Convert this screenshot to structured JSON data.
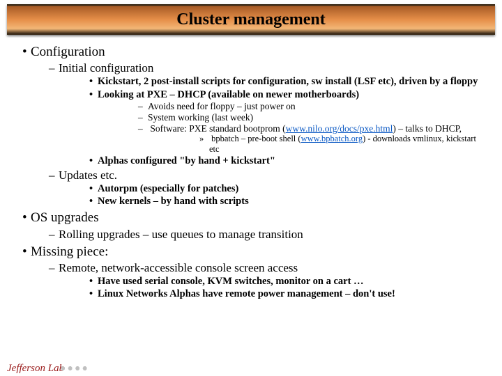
{
  "title": "Cluster management",
  "logo": "Jefferson Lab",
  "b1": {
    "text": "Configuration",
    "s1": {
      "text": "Initial configuration",
      "i1": "Kickstart, 2 post-install scripts for configuration, sw install (LSF etc), driven by a floppy",
      "i2": {
        "text": "Looking at PXE – DHCP (available on newer motherboards)",
        "d1": "Avoids need for floppy – just power on",
        "d2": "System working (last week)",
        "d3a": "Software: PXE standard bootprom (",
        "d3link": "www.nilo.org/docs/pxe.html",
        "d3b": ") – talks to DHCP,",
        "d3s1a": "bpbatch – pre-boot shell (",
        "d3s1link": "www.bpbatch.org",
        "d3s1b": ") - downloads vmlinux, kickstart etc"
      },
      "i3": "Alphas configured \"by hand + kickstart\""
    },
    "s2": {
      "text": "Updates etc.",
      "i1": "Autorpm (especially for patches)",
      "i2": "New kernels – by hand with scripts"
    }
  },
  "b2": {
    "text": "OS upgrades",
    "s1": "Rolling upgrades – use queues to manage transition"
  },
  "b3": {
    "text": "Missing piece:",
    "s1": {
      "text": "Remote, network-accessible console screen access",
      "i1": "Have used serial console, KVM switches, monitor on a cart …",
      "i2": "Linux Networks Alphas have remote power management – don't use!"
    }
  }
}
